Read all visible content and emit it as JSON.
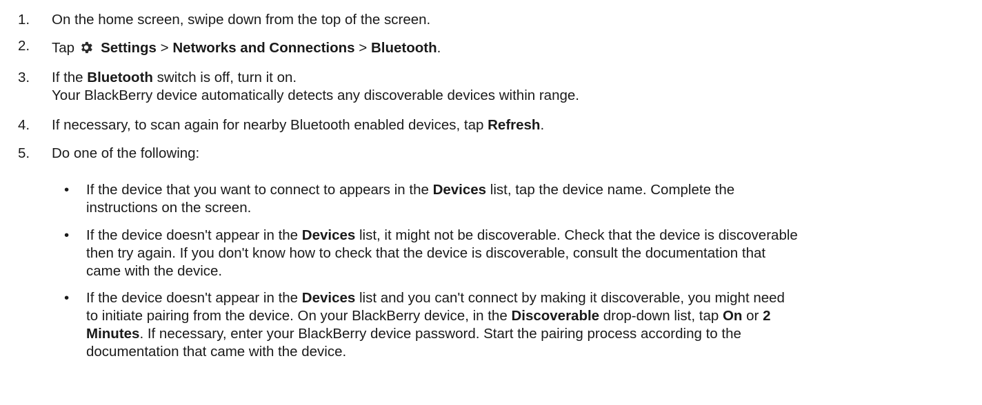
{
  "steps": [
    {
      "number": "1.",
      "parts": [
        "On the home screen, swipe down from the top of the screen."
      ]
    },
    {
      "number": "2.",
      "prefix": "Tap",
      "icon": "gear-icon",
      "settings": "Settings",
      "sep1": " > ",
      "networks": "Networks and Connections",
      "sep2": " > ",
      "bluetooth": "Bluetooth",
      "end": "."
    },
    {
      "number": "3.",
      "pre": "If the ",
      "bold": "Bluetooth",
      "post": " switch is off, turn it on.",
      "line2": "Your BlackBerry device automatically detects any discoverable devices within range."
    },
    {
      "number": "4.",
      "pre": "If necessary, to scan again for nearby Bluetooth enabled devices, tap ",
      "bold": "Refresh",
      "post": "."
    },
    {
      "number": "5.",
      "text": "Do one of the following:"
    }
  ],
  "bullets": [
    {
      "symbol": "•",
      "l1_pre": "If the device that you want to connect to appears in the ",
      "l1_bold": "Devices",
      "l1_post": " list, tap the device name. Complete the",
      "l2": "instructions on the screen."
    },
    {
      "symbol": "•",
      "l1_pre": "If the device doesn't appear in the ",
      "l1_bold": "Devices",
      "l1_post": " list, it might not be discoverable. Check that the device is discoverable",
      "l2": "then try again. If you don't know how to check that the device is discoverable, consult the documentation that",
      "l3": "came with the device."
    },
    {
      "symbol": "•",
      "l1_pre": "If the device doesn't appear in the ",
      "l1_bold": "Devices",
      "l1_post": " list and you can't connect by making it discoverable, you might need",
      "l2_pre": "to initiate pairing from the device. On your BlackBerry device, in the ",
      "l2_bold1": "Discoverable",
      "l2_mid1": " drop-down list, tap ",
      "l2_bold2": "On",
      "l2_mid2": " or ",
      "l2_bold3": "2",
      "l3_bold": "Minutes",
      "l3_post": ". If necessary, enter your BlackBerry device password. Start the pairing process according to the",
      "l4": "documentation that came with the device."
    }
  ],
  "colors": {
    "text": "#1a1a1a",
    "background": "#ffffff"
  }
}
